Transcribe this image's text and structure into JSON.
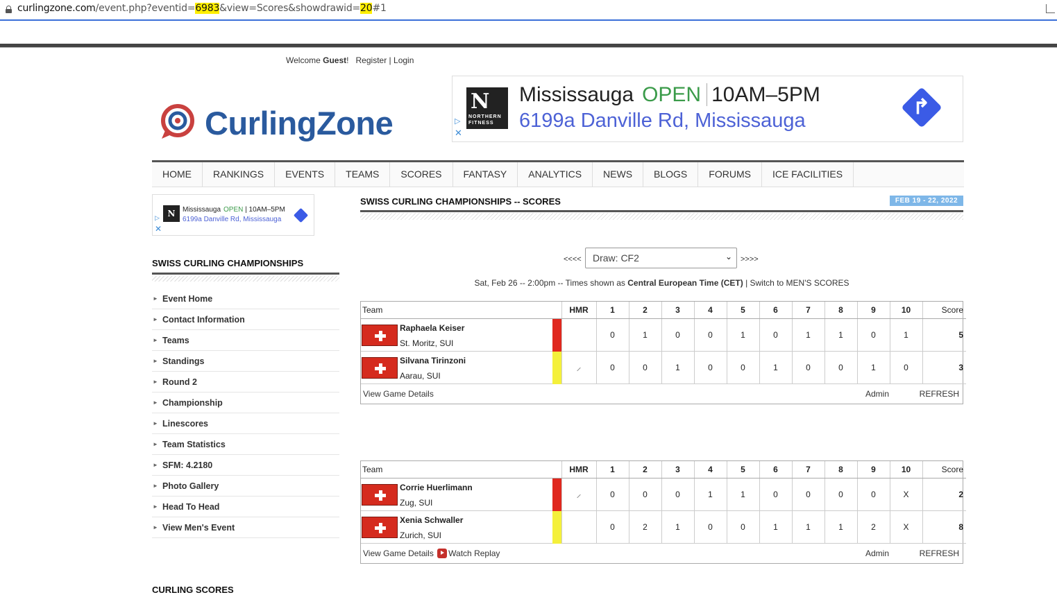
{
  "browser": {
    "url_domain": "curlingzone.com",
    "url_path1": "/event.php?eventid=",
    "url_hl1": "6983",
    "url_path2": "&view=Scores&showdrawid=",
    "url_hl2": "20",
    "url_path3": "#1"
  },
  "header": {
    "welcome": "Welcome",
    "guest": "Guest",
    "welcome_tail": "!",
    "register": "Register",
    "sep": "|",
    "login": "Login",
    "logo_text": "CurlingZone"
  },
  "ad_top": {
    "brand_n": "N",
    "brand_line1": "NORTHERN",
    "brand_line2": "FITNESS",
    "city": "Mississauga",
    "status": "OPEN",
    "hours": "10AM–5PM",
    "address": "6199a Danville Rd, Mississauga",
    "choice": "▷",
    "close": "✕"
  },
  "nav": [
    "HOME",
    "RANKINGS",
    "EVENTS",
    "TEAMS",
    "SCORES",
    "FANTASY",
    "ANALYTICS",
    "NEWS",
    "BLOGS",
    "FORUMS",
    "ICE FACILITIES"
  ],
  "ad_side": {
    "brand_n": "N",
    "city": "Mississauga",
    "status": "OPEN",
    "hours": "10AM–5PM",
    "address": "6199a Danville Rd, Mississauga",
    "choice": "▷",
    "close": "✕"
  },
  "sidebar": {
    "title": "SWISS CURLING CHAMPIONSHIPS",
    "items": [
      "Event Home",
      "Contact Information",
      "Teams",
      "Standings",
      "Round 2",
      "Championship",
      "Linescores",
      "Team Statistics",
      "SFM: 4.2180",
      "Photo Gallery",
      "Head To Head",
      "View Men's Event"
    ],
    "bottom_title": "CURLING SCORES"
  },
  "main": {
    "title": "SWISS CURLING CHAMPIONSHIPS -- SCORES",
    "date_badge": "FEB 19 - 22, 2022",
    "prev": "<<<<",
    "next": ">>>>",
    "draw_select": "Draw: CF2",
    "time_prefix": "Sat, Feb 26 -- 2:00pm -- Times shown as",
    "time_zone": "Central European Time (CET)",
    "time_suffix": "| Switch to MEN'S SCORES"
  },
  "table_headers": {
    "team": "Team",
    "hmr": "HMR",
    "ends": [
      "1",
      "2",
      "3",
      "4",
      "5",
      "6",
      "7",
      "8",
      "9",
      "10"
    ],
    "score": "Score"
  },
  "games": [
    {
      "teams": [
        {
          "name": "Raphaela Keiser",
          "location": "St. Moritz, SUI",
          "stone": "red",
          "hammer": "",
          "ends": [
            "0",
            "1",
            "0",
            "0",
            "1",
            "0",
            "1",
            "1",
            "0",
            "1"
          ],
          "score": "5"
        },
        {
          "name": "Silvana Tirinzoni",
          "location": "Aarau, SUI",
          "stone": "yellow",
          "hammer": "⸝",
          "ends": [
            "0",
            "0",
            "1",
            "0",
            "0",
            "1",
            "0",
            "0",
            "1",
            "0"
          ],
          "score": "3"
        }
      ],
      "footer": {
        "details": "View Game Details",
        "replay": "",
        "admin": "Admin",
        "refresh": "REFRESH"
      }
    },
    {
      "teams": [
        {
          "name": "Corrie Huerlimann",
          "location": "Zug, SUI",
          "stone": "red",
          "hammer": "⸝",
          "ends": [
            "0",
            "0",
            "0",
            "1",
            "1",
            "0",
            "0",
            "0",
            "0",
            "X"
          ],
          "score": "2"
        },
        {
          "name": "Xenia Schwaller",
          "location": "Zurich, SUI",
          "stone": "yellow",
          "hammer": "",
          "ends": [
            "0",
            "2",
            "1",
            "0",
            "0",
            "1",
            "1",
            "1",
            "2",
            "X"
          ],
          "score": "8"
        }
      ],
      "footer": {
        "details": "View Game Details",
        "replay": "Watch Replay",
        "admin": "Admin",
        "refresh": "REFRESH"
      }
    }
  ]
}
